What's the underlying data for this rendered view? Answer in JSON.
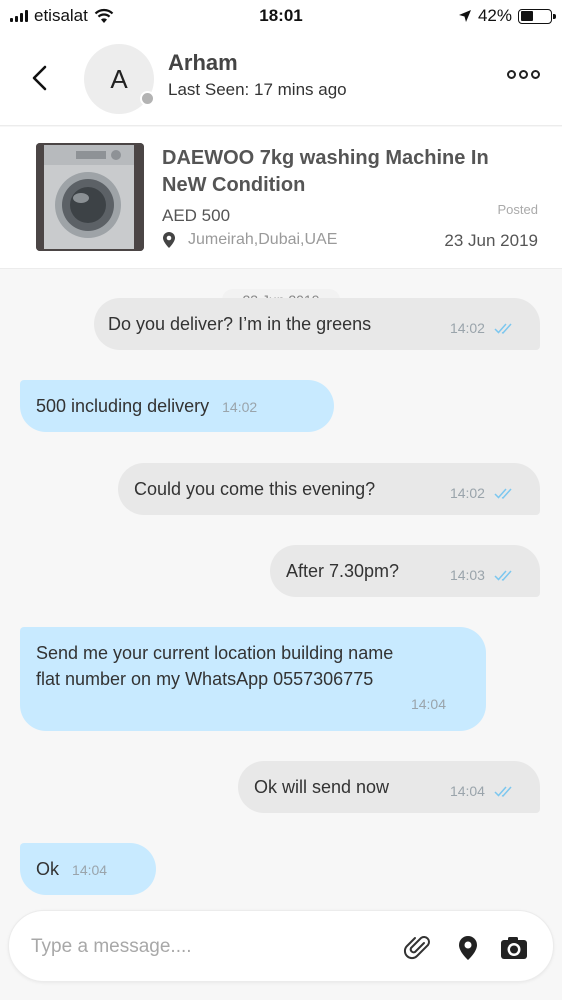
{
  "status_bar": {
    "carrier": "etisalat",
    "time": "18:01",
    "battery": "42%",
    "battery_level": 0.42
  },
  "header": {
    "avatar_initial": "A",
    "name": "Arham",
    "last_seen": "Last Seen: 17 mins ago"
  },
  "product": {
    "title": "DAEWOO 7kg washing Machine In NeW Condition",
    "price": "AED 500",
    "location": "Jumeirah,Dubai,UAE",
    "posted_label": "Posted",
    "posted_date": "23 Jun 2019"
  },
  "chat": {
    "date_separator": "23 Jun 2019",
    "messages": [
      {
        "direction": "out",
        "text": "Do you deliver? I’m in the greens",
        "time": "14:02",
        "status": "read"
      },
      {
        "direction": "in",
        "text": "500 including delivery",
        "time": "14:02"
      },
      {
        "direction": "out",
        "text": "Could you come this evening?",
        "time": "14:02",
        "status": "read"
      },
      {
        "direction": "out",
        "text": "After 7.30pm?",
        "time": "14:03",
        "status": "read"
      },
      {
        "direction": "in",
        "text": "Send me your current location building name flat number on my WhatsApp 0557306775",
        "time": "14:04"
      },
      {
        "direction": "out",
        "text": "Ok will send now",
        "time": "14:04",
        "status": "read"
      },
      {
        "direction": "in",
        "text": "Ok",
        "time": "14:04"
      }
    ]
  },
  "composer": {
    "placeholder": "Type a message....",
    "icons": [
      "paperclip-icon",
      "location-pin-icon",
      "camera-icon"
    ]
  },
  "colors": {
    "incoming_bubble": "#c8eaff",
    "outgoing_bubble": "#e8e8e8",
    "read_check": "#7cc7ef"
  }
}
